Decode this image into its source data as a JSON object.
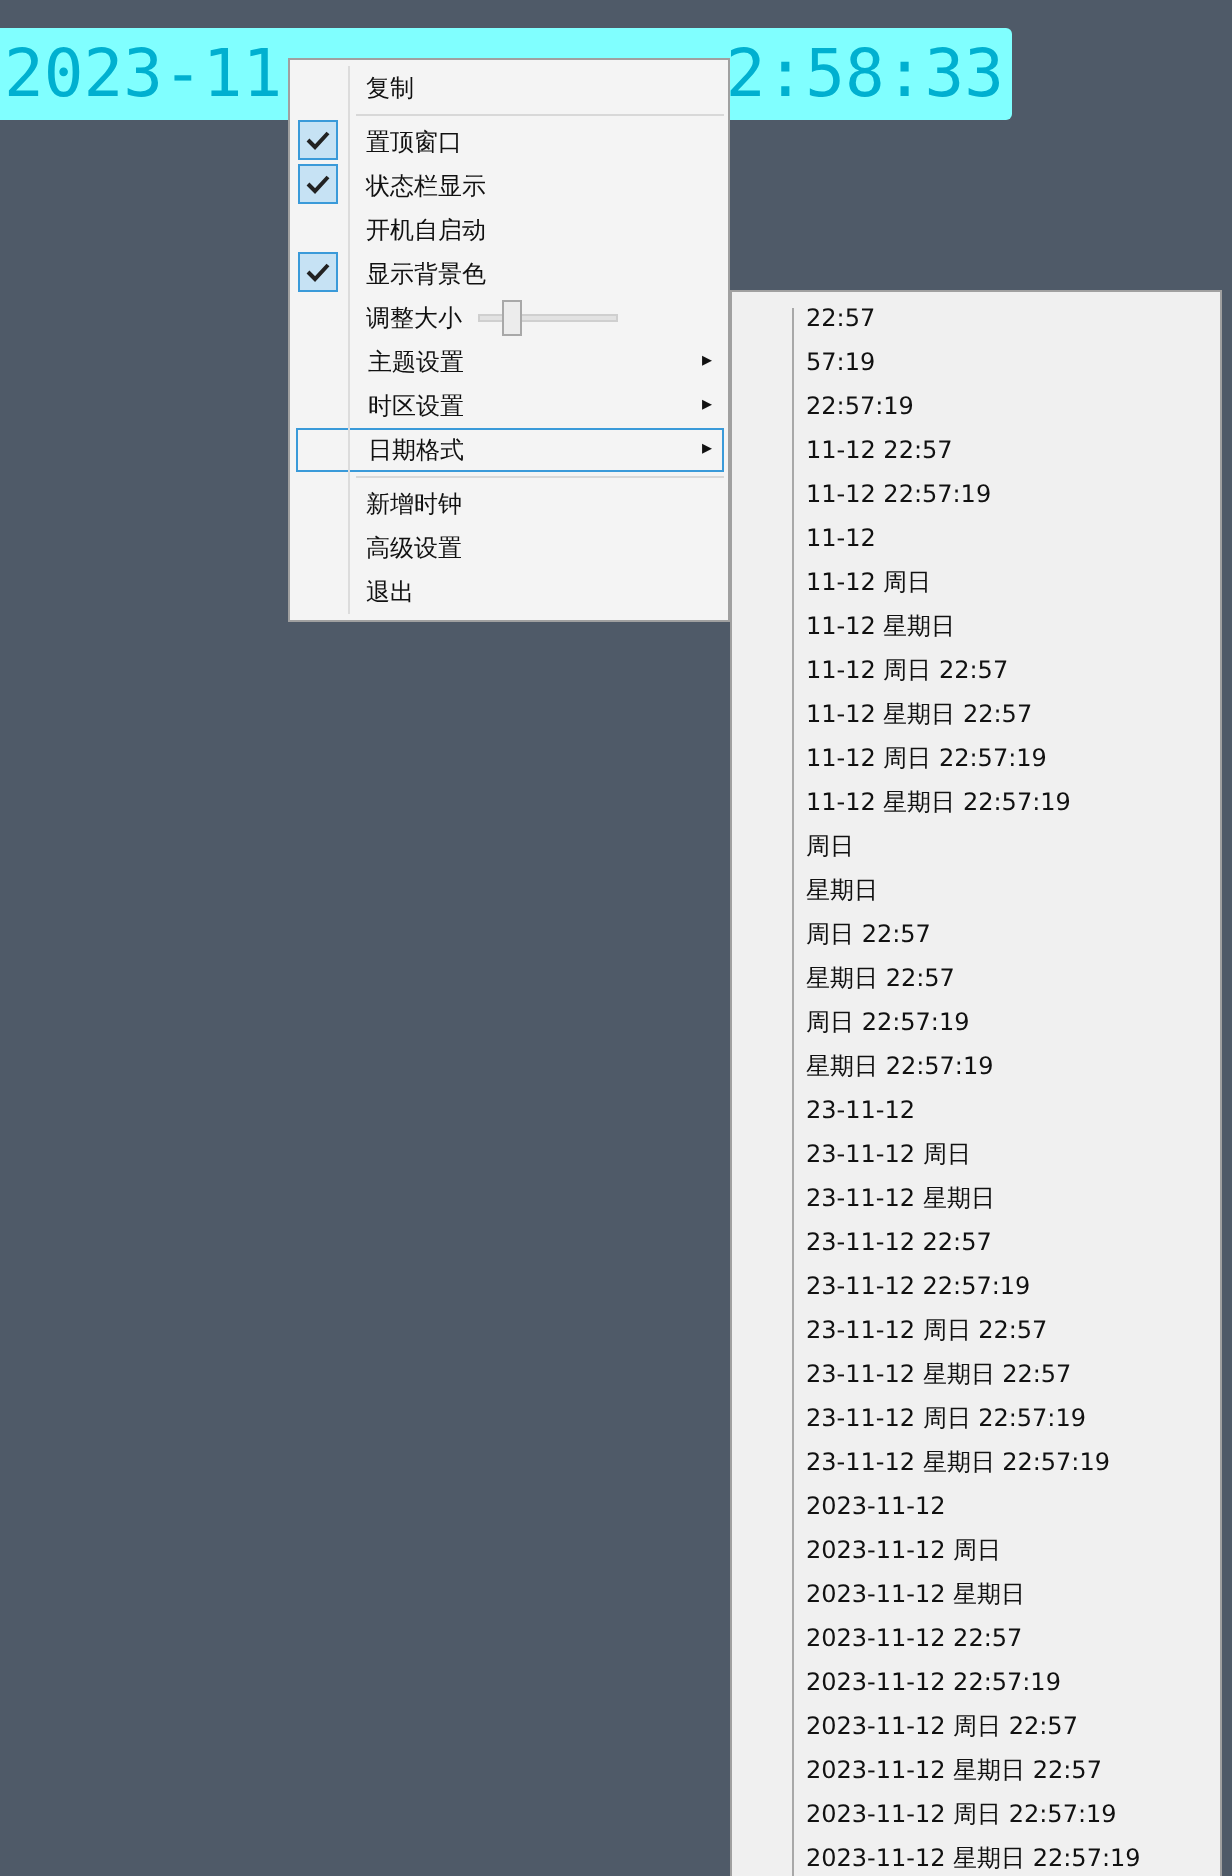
{
  "clock": {
    "date_part": "2023-11",
    "time_part": "2:58:33"
  },
  "context_menu": {
    "items": [
      {
        "kind": "action",
        "label": "复制"
      },
      {
        "kind": "separator"
      },
      {
        "kind": "check",
        "label": "置顶窗口",
        "checked": true
      },
      {
        "kind": "check",
        "label": "状态栏显示",
        "checked": true
      },
      {
        "kind": "check",
        "label": "开机自启动",
        "checked": false
      },
      {
        "kind": "check",
        "label": "显示背景色",
        "checked": true
      },
      {
        "kind": "slider",
        "label": "调整大小",
        "level": 0.26
      },
      {
        "kind": "submenu",
        "label": "主题设置",
        "arrow": "▸",
        "selected": false
      },
      {
        "kind": "submenu",
        "label": "时区设置",
        "arrow": "▸",
        "selected": false
      },
      {
        "kind": "submenu",
        "label": "日期格式",
        "arrow": "▸",
        "selected": true
      },
      {
        "kind": "separator"
      },
      {
        "kind": "action",
        "label": "新增时钟"
      },
      {
        "kind": "action",
        "label": "高级设置"
      },
      {
        "kind": "action",
        "label": "退出"
      }
    ]
  },
  "date_format_submenu": {
    "items": [
      "22:57",
      "57:19",
      "22:57:19",
      "11-12 22:57",
      "11-12 22:57:19",
      "11-12",
      "11-12 周日",
      "11-12 星期日",
      "11-12 周日 22:57",
      "11-12 星期日 22:57",
      "11-12 周日 22:57:19",
      "11-12 星期日 22:57:19",
      "周日",
      "星期日",
      "周日 22:57",
      "星期日 22:57",
      "周日 22:57:19",
      "星期日 22:57:19",
      "23-11-12",
      "23-11-12 周日",
      "23-11-12 星期日",
      "23-11-12 22:57",
      "23-11-12 22:57:19",
      "23-11-12 周日 22:57",
      "23-11-12 星期日 22:57",
      "23-11-12 周日 22:57:19",
      "23-11-12 星期日 22:57:19",
      "2023-11-12",
      "2023-11-12 周日",
      "2023-11-12 星期日",
      "2023-11-12 22:57",
      "2023-11-12 22:57:19",
      "2023-11-12 周日 22:57",
      "2023-11-12 星期日 22:57",
      "2023-11-12 周日 22:57:19",
      "2023-11-12 星期日 22:57:19"
    ]
  }
}
